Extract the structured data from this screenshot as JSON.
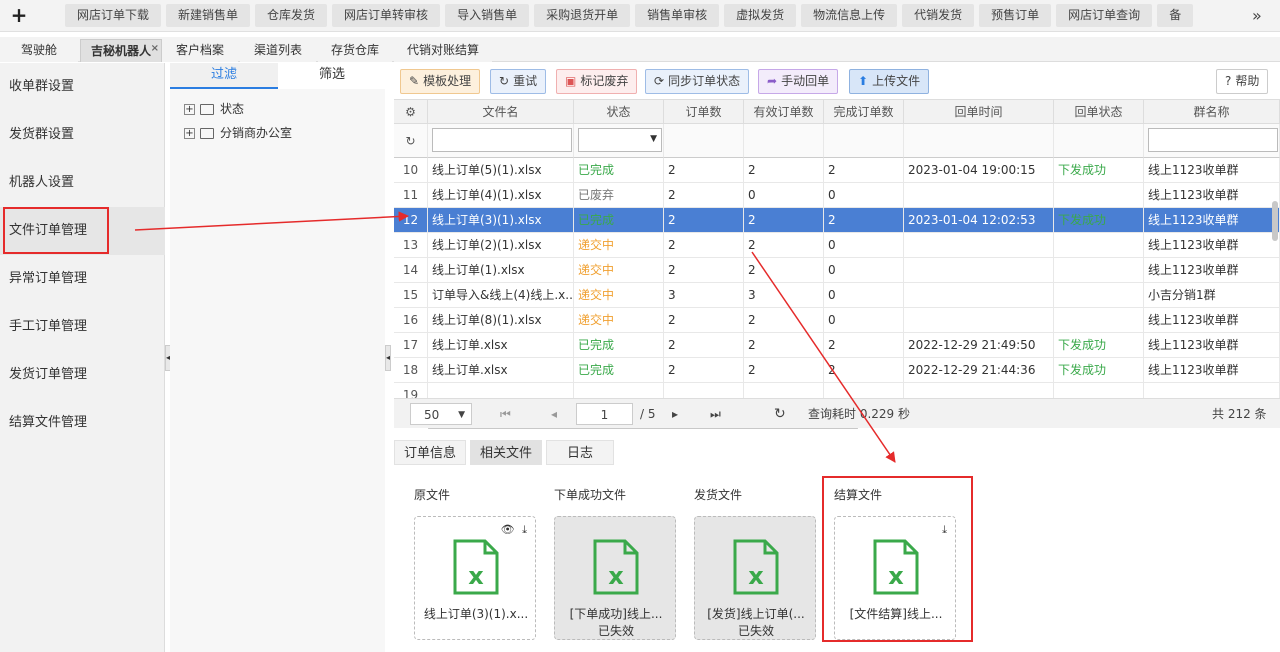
{
  "topbar": {
    "tabs": [
      "网店订单下载",
      "新建销售单",
      "仓库发货",
      "网店订单转审核",
      "导入销售单",
      "采购退货开单",
      "销售单审核",
      "虚拟发货",
      "物流信息上传",
      "代销发货",
      "预售订单",
      "网店订单查询",
      "备"
    ],
    "next": "»"
  },
  "subtabs": [
    {
      "label": "驾驶舱",
      "active": false
    },
    {
      "label": "吉秘机器人",
      "active": true
    },
    {
      "label": "客户档案",
      "active": false
    },
    {
      "label": "渠道列表",
      "active": false
    },
    {
      "label": "存货仓库",
      "active": false
    },
    {
      "label": "代销对账结算",
      "active": false
    }
  ],
  "sidebar": [
    "收单群设置",
    "发货群设置",
    "机器人设置",
    "文件订单管理",
    "异常订单管理",
    "手工订单管理",
    "发货订单管理",
    "结算文件管理"
  ],
  "filter": {
    "tabs": [
      "过滤",
      "筛选"
    ],
    "tree": [
      "状态",
      "分销商办公室"
    ]
  },
  "toolbar": {
    "template": "模板处理",
    "retry": "重试",
    "discard": "标记废弃",
    "sync": "同步订单状态",
    "manual": "手动回单",
    "upload": "上传文件",
    "help": "帮助"
  },
  "grid": {
    "columns": [
      "文件名",
      "状态",
      "订单数",
      "有效订单数",
      "完成订单数",
      "回单时间",
      "回单状态",
      "群名称"
    ],
    "rows": [
      {
        "no": "10",
        "file": "线上订单(5)(1).xlsx",
        "status": "已完成",
        "orders": "2",
        "valid": "2",
        "done": "2",
        "time": "2023-01-04 19:00:15",
        "rstatus": "下发成功",
        "group": "线上1123收单群",
        "sel": false
      },
      {
        "no": "11",
        "file": "线上订单(4)(1).xlsx",
        "status": "已废弃",
        "orders": "2",
        "valid": "0",
        "done": "0",
        "time": "",
        "rstatus": "",
        "group": "线上1123收单群",
        "sel": false
      },
      {
        "no": "12",
        "file": "线上订单(3)(1).xlsx",
        "status": "已完成",
        "orders": "2",
        "valid": "2",
        "done": "2",
        "time": "2023-01-04 12:02:53",
        "rstatus": "下发成功",
        "group": "线上1123收单群",
        "sel": true
      },
      {
        "no": "13",
        "file": "线上订单(2)(1).xlsx",
        "status": "递交中",
        "orders": "2",
        "valid": "2",
        "done": "0",
        "time": "",
        "rstatus": "",
        "group": "线上1123收单群",
        "sel": false
      },
      {
        "no": "14",
        "file": "线上订单(1).xlsx",
        "status": "递交中",
        "orders": "2",
        "valid": "2",
        "done": "0",
        "time": "",
        "rstatus": "",
        "group": "线上1123收单群",
        "sel": false
      },
      {
        "no": "15",
        "file": "订单导入&线上(4)线上.x...",
        "status": "递交中",
        "orders": "3",
        "valid": "3",
        "done": "0",
        "time": "",
        "rstatus": "",
        "group": "小吉分销1群",
        "sel": false
      },
      {
        "no": "16",
        "file": "线上订单(8)(1).xlsx",
        "status": "递交中",
        "orders": "2",
        "valid": "2",
        "done": "0",
        "time": "",
        "rstatus": "",
        "group": "线上1123收单群",
        "sel": false
      },
      {
        "no": "17",
        "file": "线上订单.xlsx",
        "status": "已完成",
        "orders": "2",
        "valid": "2",
        "done": "2",
        "time": "2022-12-29 21:49:50",
        "rstatus": "下发成功",
        "group": "线上1123收单群",
        "sel": false
      },
      {
        "no": "18",
        "file": "线上订单.xlsx",
        "status": "已完成",
        "orders": "2",
        "valid": "2",
        "done": "2",
        "time": "2022-12-29 21:44:36",
        "rstatus": "下发成功",
        "group": "线上1123收单群",
        "sel": false
      },
      {
        "no": "19",
        "file": "",
        "status": "",
        "orders": "",
        "valid": "",
        "done": "",
        "time": "",
        "rstatus": "",
        "group": "",
        "sel": false
      }
    ]
  },
  "pager": {
    "page_size": "50",
    "page": "1",
    "total_pages": "/ 5",
    "query_time": "查询耗时 0.229 秒",
    "total": "共 212 条"
  },
  "detail": {
    "tabs": [
      "订单信息",
      "相关文件",
      "日志"
    ],
    "active": 1,
    "sections": [
      {
        "title": "原文件",
        "name": "线上订单(3)(1).x...",
        "status": "",
        "disabled": false,
        "icons": "👁 ⤓"
      },
      {
        "title": "下单成功文件",
        "name": "[下单成功]线上...",
        "status": "已失效",
        "disabled": true,
        "icons": ""
      },
      {
        "title": "发货文件",
        "name": "[发货]线上订单(...",
        "status": "已失效",
        "disabled": true,
        "icons": ""
      },
      {
        "title": "结算文件",
        "name": "[文件结算]线上...",
        "status": "",
        "disabled": false,
        "icons": "⤓"
      }
    ]
  },
  "colors": {
    "accent": "#2a7de1",
    "selected_row": "#4a7fd3",
    "completed": "#3aa94a",
    "discarded": "#777777",
    "submitting": "#f0a030",
    "highlight": "#e52b2b",
    "excel": "#3aa94a"
  }
}
